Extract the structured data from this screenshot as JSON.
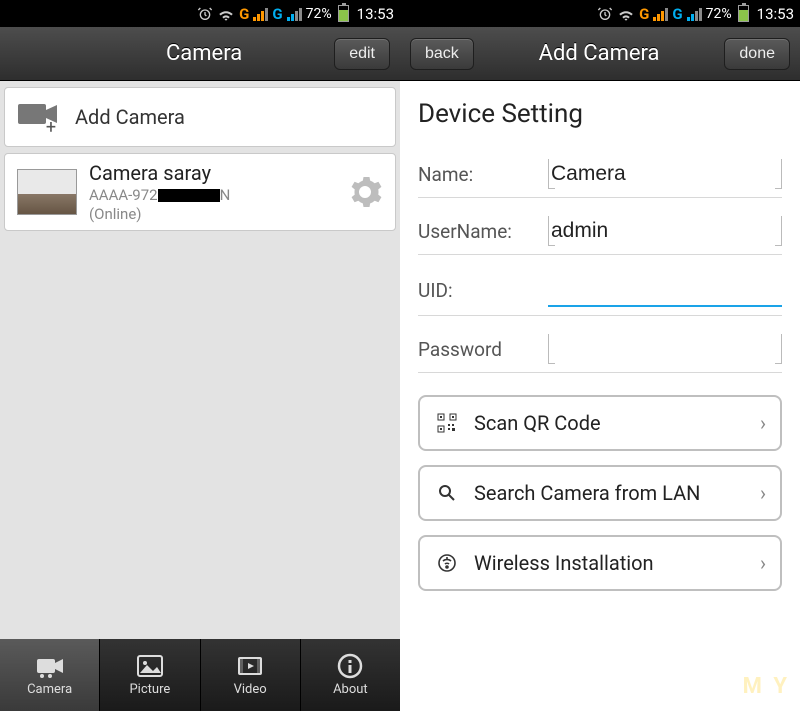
{
  "status": {
    "battery_pct": "72%",
    "time": "13:53"
  },
  "left": {
    "header_title": "Camera",
    "edit_label": "edit",
    "add_camera_label": "Add Camera",
    "camera": {
      "name": "Camera saray",
      "uid_prefix": "AAAA-972",
      "uid_suffix": "N",
      "status": "(Online)"
    },
    "nav": {
      "camera": "Camera",
      "picture": "Picture",
      "video": "Video",
      "about": "About"
    }
  },
  "right": {
    "back_label": "back",
    "header_title": "Add Camera",
    "done_label": "done",
    "section_title": "Device Setting",
    "fields": {
      "name_label": "Name:",
      "name_value": "Camera",
      "username_label": "UserName:",
      "username_value": "admin",
      "uid_label": "UID:",
      "uid_value": "",
      "password_label": "Password",
      "password_value": ""
    },
    "actions": {
      "scan_qr": "Scan QR Code",
      "search_lan": "Search Camera from LAN",
      "wireless": "Wireless Installation"
    }
  }
}
